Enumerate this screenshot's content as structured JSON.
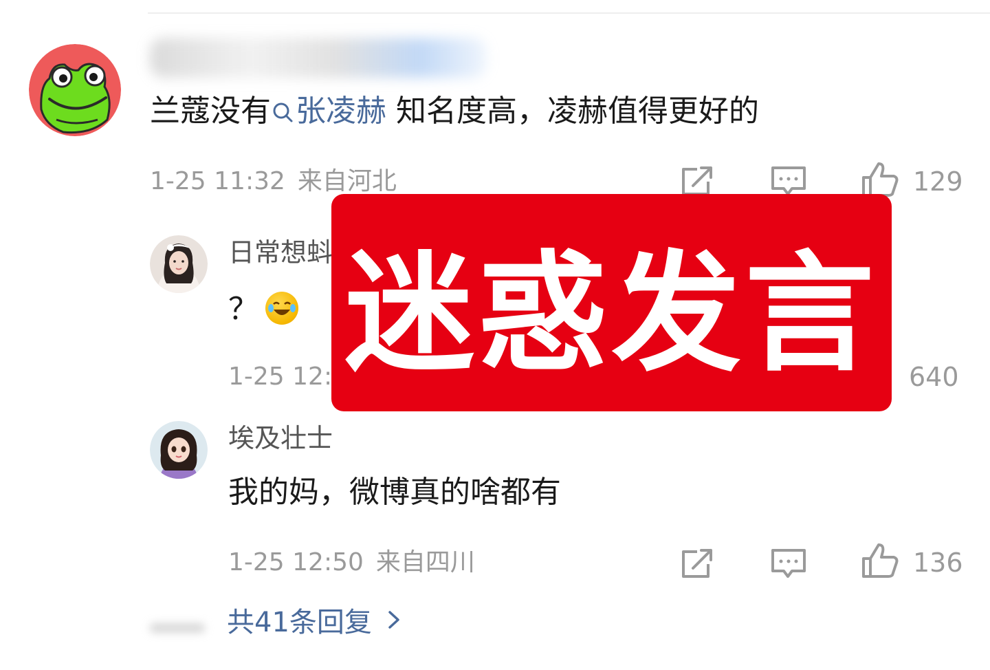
{
  "comments": [
    {
      "text_prefix": "兰蔻没有",
      "mention": "张凌赫",
      "text_suffix": " 知名度高，凌赫值得更好的",
      "time": "1-25 11:32",
      "location": "来自河北",
      "likes": "129",
      "avatar_icon": "frog-avatar-icon"
    },
    {
      "username": "日常想蚪",
      "text": "？",
      "emoji": "laughing-tears-emoji",
      "time": "1-25 12:",
      "likes": "640"
    },
    {
      "username": "埃及壮士",
      "text": "我的妈，微博真的啥都有",
      "time": "1-25 12:50",
      "location": "来自四川",
      "likes": "136"
    }
  ],
  "replies": {
    "label": "共41条回复"
  },
  "overlay": {
    "label": "迷惑发言"
  },
  "colors": {
    "overlay": "#e60012",
    "link": "#496a9b",
    "meta": "#9a9a9a"
  }
}
